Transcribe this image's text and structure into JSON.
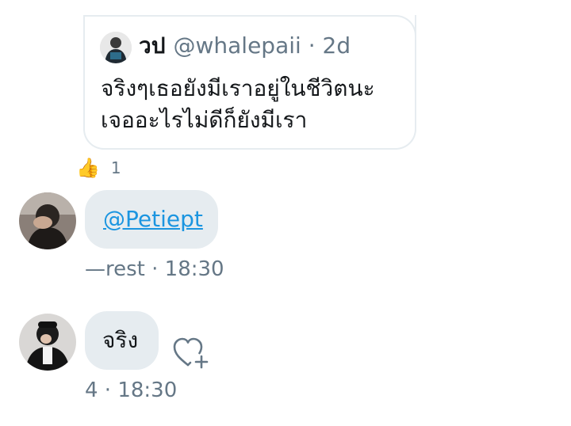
{
  "quoted_tweet": {
    "name": "วป",
    "handle": "@whalepaii",
    "separator": "·",
    "time": "2d",
    "text_line1": "จริงๆเธอยังมีเราอยู่ในชีวิตนะ",
    "text_line2": "เจออะไรไม่ดีก็ยังมีเรา"
  },
  "reaction": {
    "emoji": "👍",
    "count": "1"
  },
  "messages": [
    {
      "text": "@Petiept",
      "meta": "—rest · 18:30"
    },
    {
      "text": "จริง",
      "meta": "4 · 18:30"
    }
  ],
  "colors": {
    "bubble": "#e6ecf0",
    "mention": "#1b95e0",
    "muted": "#657786"
  },
  "icons": {
    "like_add": "heart-plus-icon",
    "reaction": "thumbs-up-icon"
  }
}
